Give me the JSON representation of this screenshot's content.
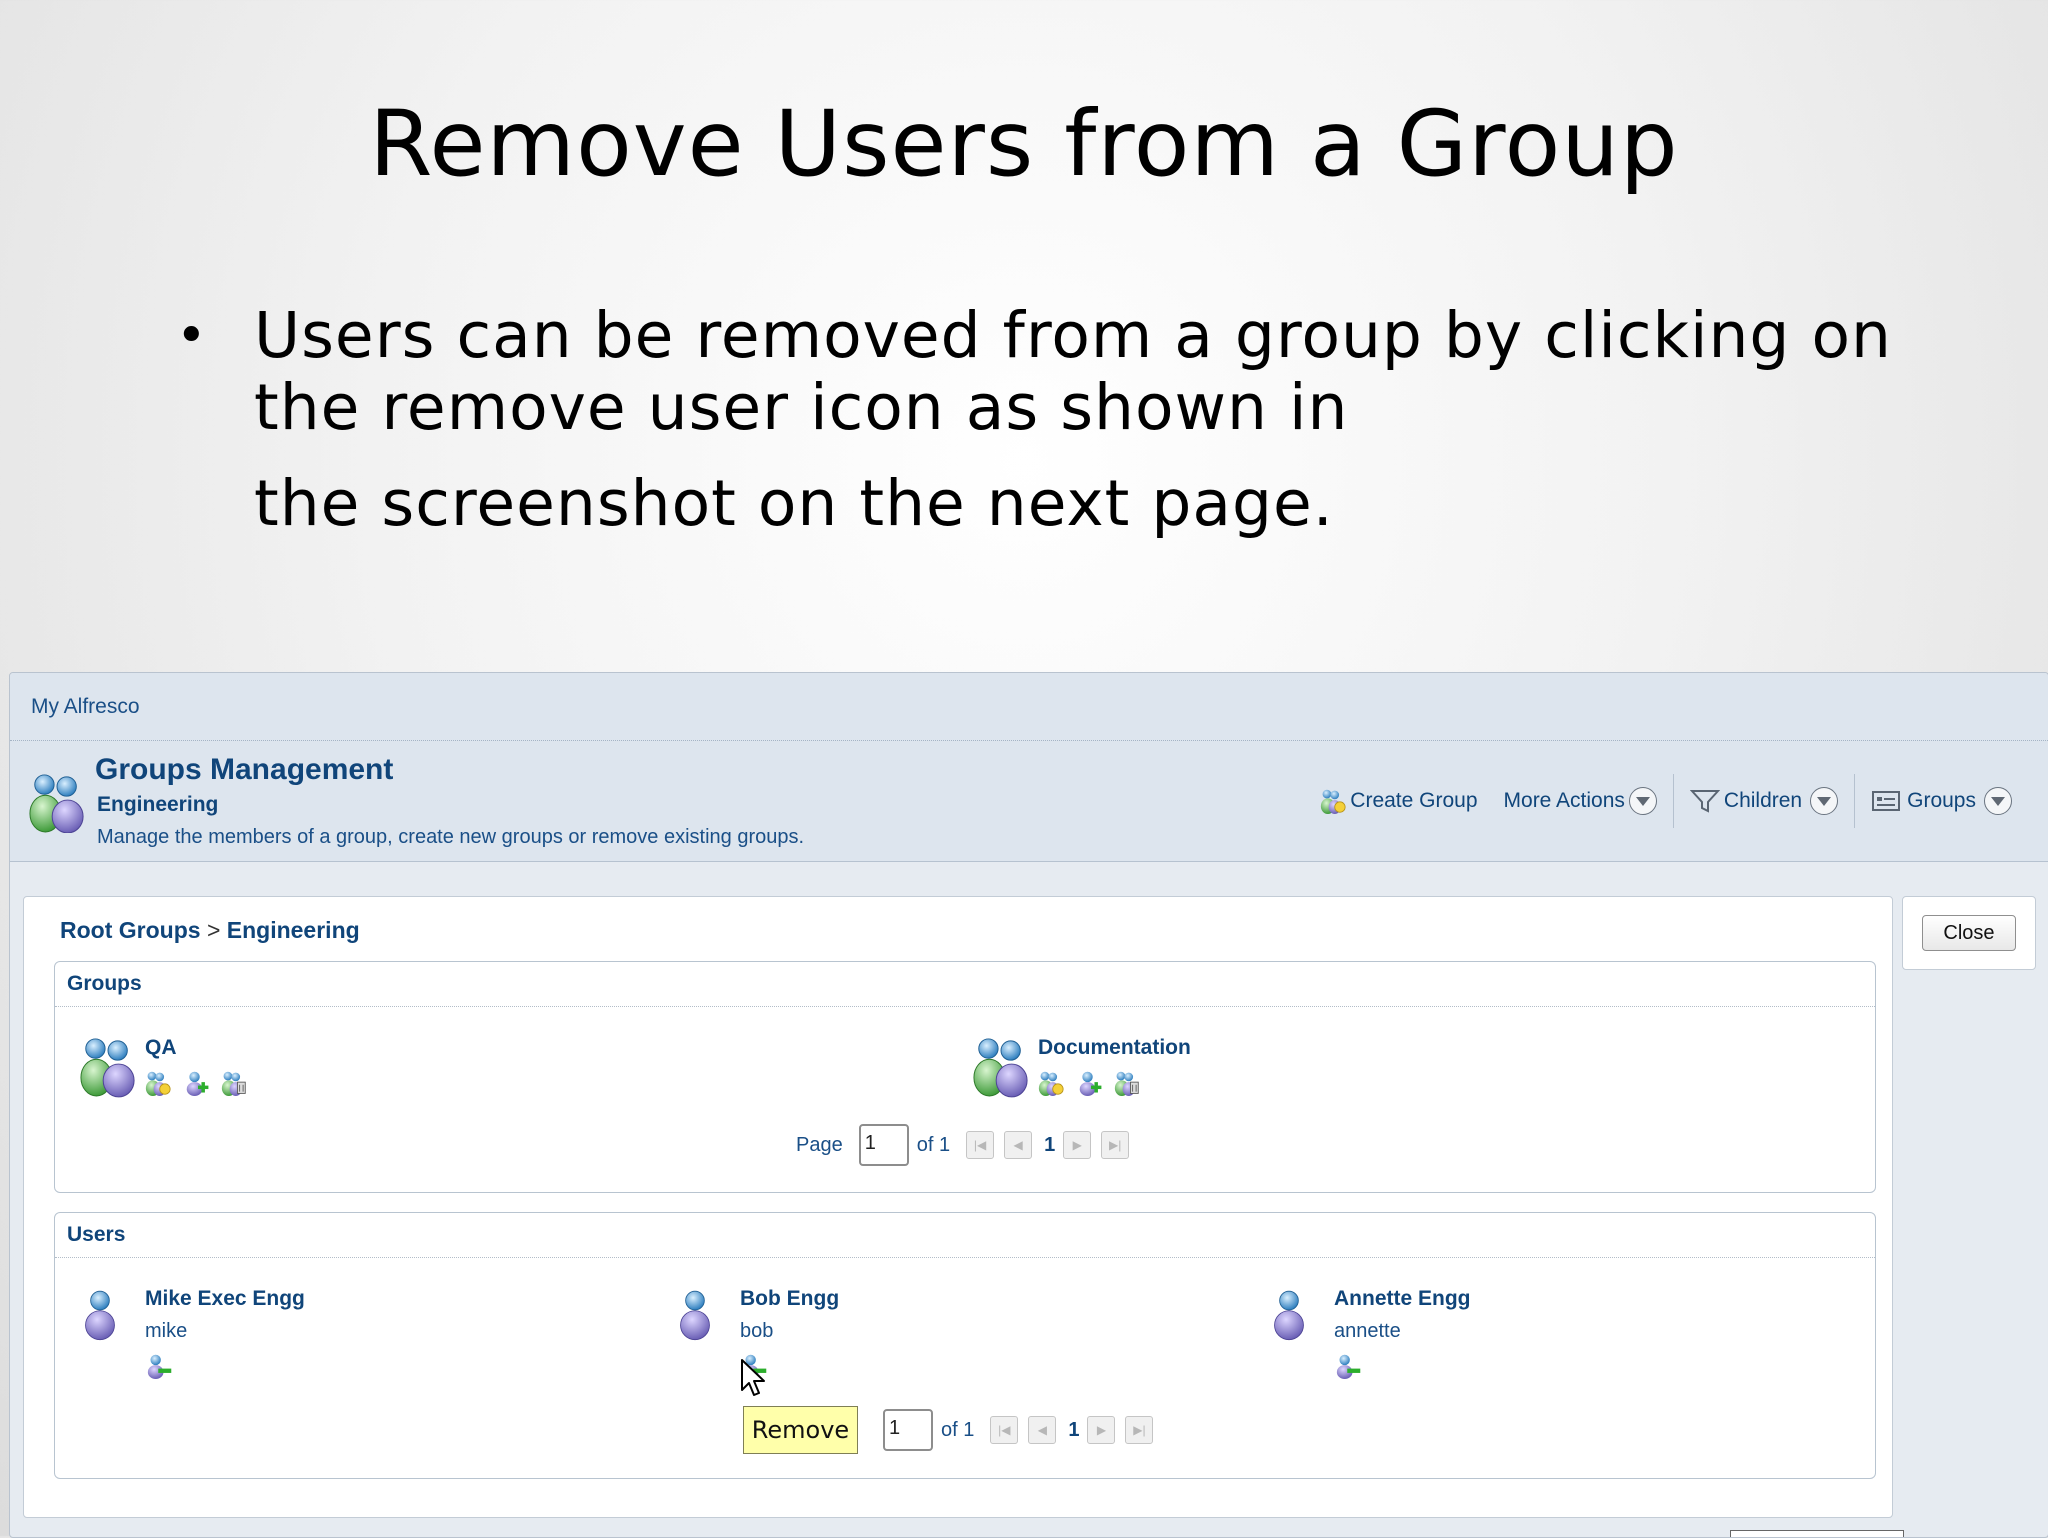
{
  "slide": {
    "title": "Remove Users from a Group",
    "bullet_symbol": "•",
    "bullet_line1": "Users can be removed from a group by clicking on",
    "bullet_line2": "the remove user icon as shown in",
    "bullet_line3": "the screenshot on the next page."
  },
  "app": {
    "nav_link": "My Alfresco",
    "title": "Groups Management",
    "subtitle": "Engineering",
    "description": "Manage the members of a group, create new groups or remove existing groups.",
    "actions": {
      "create_group": "Create Group",
      "more_actions": "More Actions",
      "children": "Children",
      "groups": "Groups"
    },
    "close_label": "Close"
  },
  "breadcrumb": {
    "root": "Root Groups",
    "separator": ">",
    "current": "Engineering"
  },
  "groups_section": {
    "heading": "Groups",
    "items": [
      {
        "name": "QA"
      },
      {
        "name": "Documentation"
      }
    ],
    "pager": {
      "page_label": "Page",
      "page_value": "1",
      "of_label": "of 1",
      "current": "1"
    }
  },
  "users_section": {
    "heading": "Users",
    "items": [
      {
        "name": "Mike Exec Engg",
        "login": "mike"
      },
      {
        "name": "Bob Engg",
        "login": "bob"
      },
      {
        "name": "Annette Engg",
        "login": "annette"
      }
    ],
    "pager": {
      "page_value": "1",
      "of_label": "of 1",
      "current": "1"
    }
  },
  "tooltip": {
    "text": "Remove"
  },
  "colors": {
    "link": "#10457a",
    "panel_bg": "#dde5ee",
    "tooltip_bg": "#ffffaa"
  },
  "icons": [
    "group-icon",
    "user-icon",
    "add-subgroup-icon",
    "add-user-icon",
    "delete-group-icon",
    "remove-user-icon",
    "filter-icon",
    "list-icon",
    "dropdown-icon",
    "pointer-cursor-icon"
  ]
}
